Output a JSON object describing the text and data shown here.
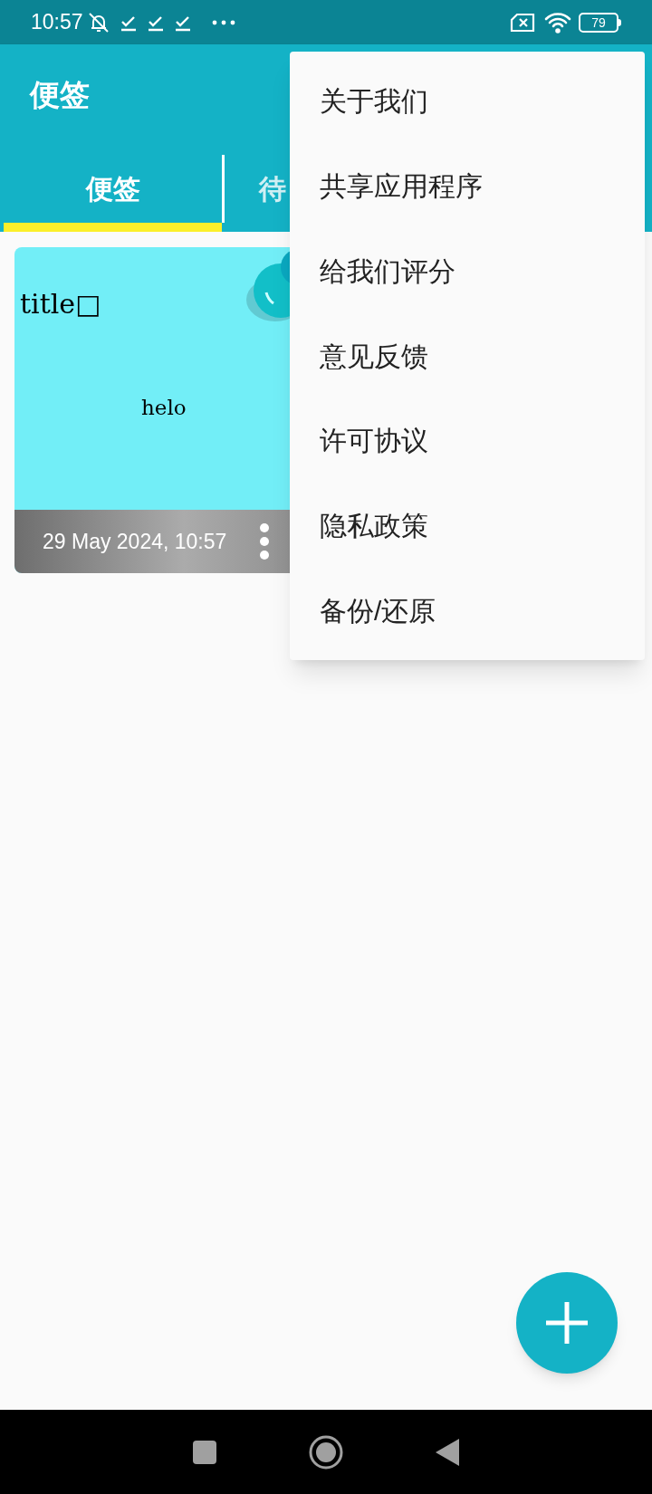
{
  "status_bar": {
    "time": "10:57",
    "battery": "79"
  },
  "app_bar": {
    "title": "便签"
  },
  "tabs": [
    {
      "label": "便签",
      "selected": true
    },
    {
      "label": "待",
      "selected": false
    }
  ],
  "notes": [
    {
      "title": "title□",
      "body": "helo",
      "date": "29 May 2024, 10:57",
      "color": "#72eef7"
    }
  ],
  "menu": {
    "items": [
      "关于我们",
      "共享应用程序",
      "给我们评分",
      "意见反馈",
      "许可协议",
      "隐私政策",
      "备份/还原"
    ]
  }
}
